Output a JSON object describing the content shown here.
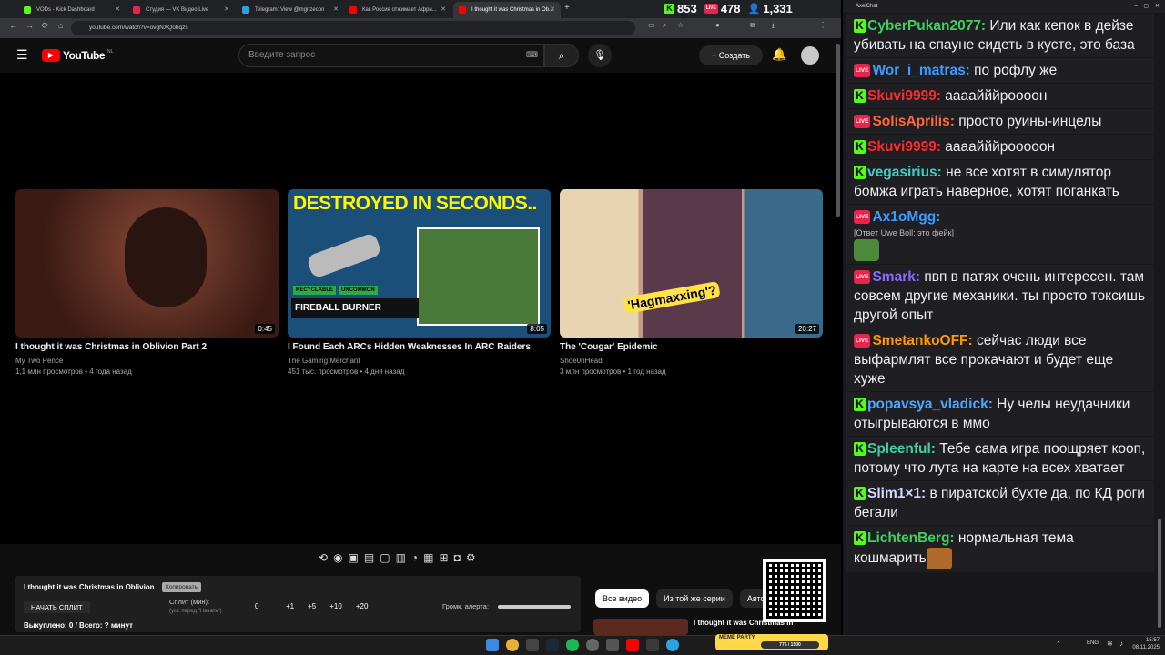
{
  "browser": {
    "tabs": [
      {
        "label": "VODs - Kick Dashboard",
        "color": "#53fc18",
        "active": false
      },
      {
        "label": "Студия — VK Видео Live",
        "color": "#e5254a",
        "active": false
      },
      {
        "label": "Telegram: View @mgnzecon",
        "color": "#2aa3e0",
        "active": false
      },
      {
        "label": "Как Россия отжимает Афри...",
        "color": "#ff0000",
        "active": false
      },
      {
        "label": "I thought it was Christmas in Ob...",
        "color": "#ff0000",
        "active": true
      }
    ],
    "url": "youtube.com/watch?v=ovgNXQohqzs"
  },
  "stats": {
    "kick_viewers": "853",
    "vk_viewers": "478",
    "total_viewers": "1,331",
    "live_label": "LIVE"
  },
  "youtube": {
    "logo_text": "YouTube",
    "region": "NL",
    "search_placeholder": "Введите запрос",
    "create_label": "Создать",
    "videos": [
      {
        "title": "I thought it was Christmas in Oblivion Part 2",
        "channel": "My Two Pence",
        "meta": "1,1 млн просмотров • 4 года назад",
        "duration": "0:45",
        "thumb_color": "#5a2a20"
      },
      {
        "title": "I Found Each ARCs Hidden Weaknesses In ARC Raiders",
        "channel": "The Gaming Merchant",
        "meta": "451 тыс. просмотров • 4 дня назад",
        "duration": "8:05",
        "thumb_color": "#1f5a8a",
        "thumb_text": "DESTROYED IN SECONDS..",
        "thumb_badge1": "RECYCLABLE",
        "thumb_badge2": "UNCOMMON",
        "thumb_label": "FIREBALL BURNER"
      },
      {
        "title": "The 'Cougar' Epidemic",
        "channel": "Shoe0nHead",
        "meta": "3 млн просмотров • 1 год назад",
        "duration": "20:27",
        "thumb_color": "#c9a77a",
        "thumb_text": "'Hagmaxxing'?"
      }
    ],
    "vod_panel": {
      "title": "I thought it was Christmas in Oblivion",
      "copy_btn": "Копировать",
      "start_split": "НАЧАТЬ СПЛИТ",
      "split_label": "Сплит (мин):",
      "split_hint": "(уст. перед \"Начать\")",
      "split_value": "0",
      "increments": [
        "+1",
        "+5",
        "+10",
        "+20"
      ],
      "alert_volume": "Громк. алерта:",
      "bought": "Выкуплено: 0 / Всего: ? минут"
    },
    "chips": [
      "Все видео",
      "Из той же серии",
      "Автор:"
    ],
    "next_video": "I thought it was Christmas in"
  },
  "chat": {
    "window_title": "AxelChat",
    "messages": [
      {
        "source": "k",
        "user": "CyberPukan2077:",
        "color": "#3fd05e",
        "text": " Или как кепок в дейзе убивать на спауне сидеть в кусте, это база"
      },
      {
        "source": "live",
        "user": "Wor_i_matras:",
        "color": "#3b9cff",
        "text": " по рофлу же"
      },
      {
        "source": "k",
        "user": "Skuvi9999:",
        "color": "#ff2a2a",
        "text": " аааайййроооон"
      },
      {
        "source": "live",
        "user": "SolisAprilis:",
        "color": "#ff6a3a",
        "text": " просто руины-инцелы"
      },
      {
        "source": "k",
        "user": "Skuvi9999:",
        "color": "#ff2a2a",
        "text": " аааайййрооооoн"
      },
      {
        "source": "k",
        "user": "vegasirius:",
        "color": "#3fd0c8",
        "text": " не все хотят в симулятор бомжа играть наверное, хотят поганкать"
      },
      {
        "source": "live",
        "user": "Ax1oMgg:",
        "color": "#3b9cff",
        "text": "",
        "reply": "[Ответ Uwe Boll: это фейк]",
        "emote": true
      },
      {
        "source": "live",
        "user": "Smark:",
        "color": "#8a6cff",
        "text": " пвп в патях очень интересен. там совсем другие механики. ты просто токсишь другой опыт"
      },
      {
        "source": "live",
        "user": "SmetankoOFF:",
        "color": "#ff9a00",
        "text": " сейчас люди все выфармлят все прокачают и будет еще хуже"
      },
      {
        "source": "k",
        "user": "popavsya_vladick:",
        "color": "#4aa8ff",
        "text": " Ну челы неудачники отыгрываются в ммо"
      },
      {
        "source": "k",
        "user": "Spleenful:",
        "color": "#3fd0a0",
        "text": " Тебе сама игра поощряет кооп, потому что лута на карте на всех хватает"
      },
      {
        "source": "k",
        "user": "Slim1×1:",
        "color": "#d8d8ff",
        "text": " в пиратской бухте да, по КД роги бегали"
      },
      {
        "source": "k",
        "user": "LichtenBerg:",
        "color": "#3fd05e",
        "text": " нормальная тема кошмарить",
        "emote": true
      }
    ]
  },
  "taskbar": {
    "lang": "ENG",
    "time": "15:57",
    "date": "08.11.2025",
    "widget_label": "MEME PARTY",
    "widget_value": "776 / 1500"
  }
}
